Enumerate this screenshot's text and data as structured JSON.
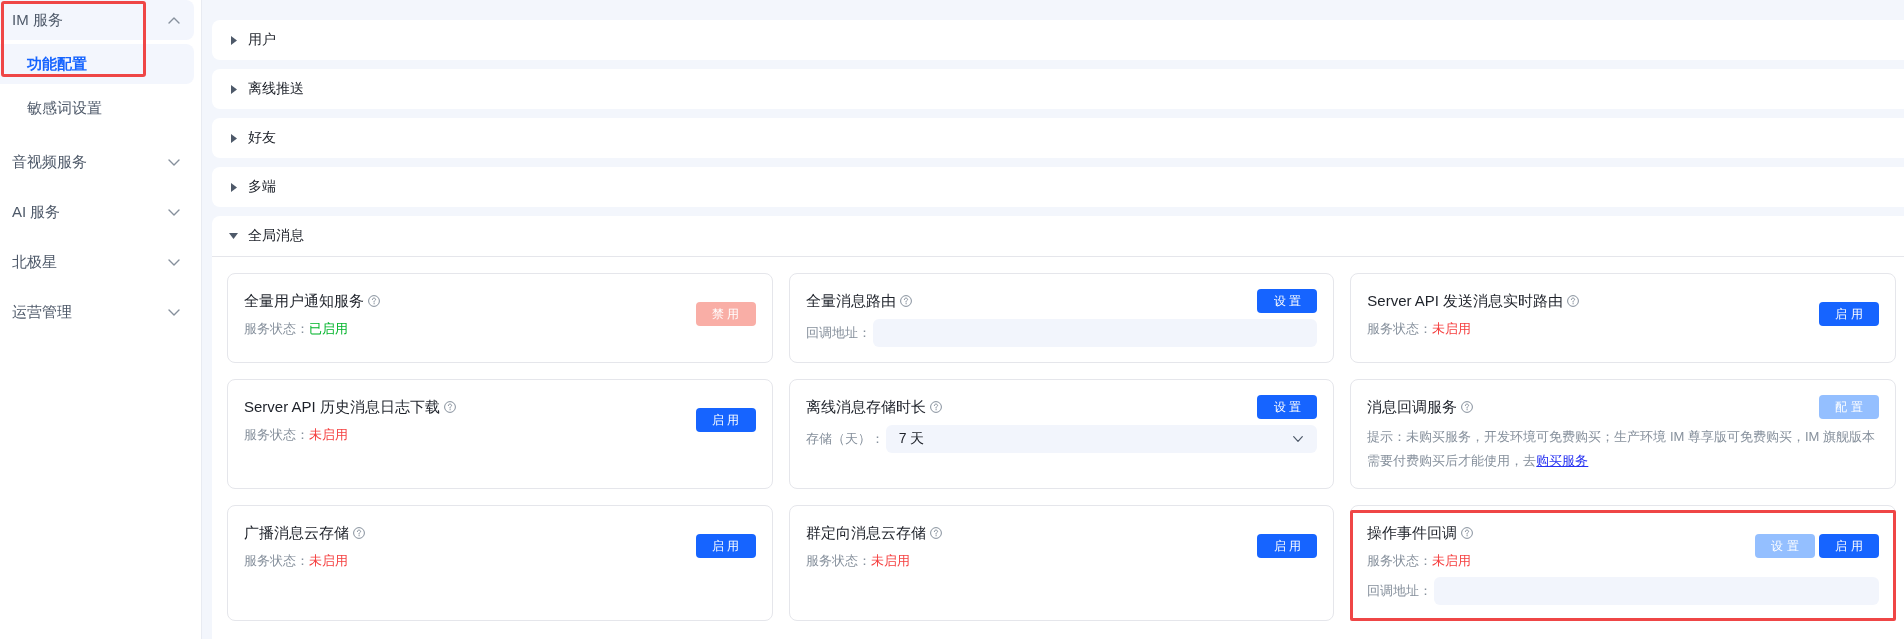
{
  "sidebar": {
    "items": [
      {
        "label": "IM 服务",
        "expanded": true,
        "highlighted": true,
        "children": [
          {
            "label": "功能配置",
            "selected": true
          },
          {
            "label": "敏感词设置",
            "selected": false
          }
        ]
      },
      {
        "label": "音视频服务",
        "expanded": false,
        "highlighted": false
      },
      {
        "label": "AI 服务",
        "expanded": false,
        "highlighted": false
      },
      {
        "label": "北极星",
        "expanded": false,
        "highlighted": false
      },
      {
        "label": "运营管理",
        "expanded": false,
        "highlighted": false
      }
    ]
  },
  "sections": [
    {
      "title": "用户",
      "expanded": false
    },
    {
      "title": "离线推送",
      "expanded": false
    },
    {
      "title": "好友",
      "expanded": false
    },
    {
      "title": "多端",
      "expanded": false
    },
    {
      "title": "全局消息",
      "expanded": true,
      "cards": [
        {
          "title": "全量用户通知服务",
          "highlighted": false,
          "status": {
            "label": "服务状态：",
            "value": "已启用",
            "enabled": true
          },
          "buttons": [
            {
              "label": "禁 用",
              "kind": "danger",
              "disabled": true
            }
          ]
        },
        {
          "title": "全量消息路由",
          "highlighted": false,
          "buttons": [
            {
              "label": "设 置",
              "kind": "primary",
              "disabled": false
            }
          ],
          "field": {
            "kind": "input",
            "label": "回调地址："
          }
        },
        {
          "title": "Server API 发送消息实时路由",
          "highlighted": false,
          "status": {
            "label": "服务状态：",
            "value": "未启用",
            "enabled": false
          },
          "buttons": [
            {
              "label": "启 用",
              "kind": "primary",
              "disabled": false
            }
          ]
        },
        {
          "title": "Server API 历史消息日志下载",
          "highlighted": false,
          "status": {
            "label": "服务状态：",
            "value": "未启用",
            "enabled": false
          },
          "buttons": [
            {
              "label": "启 用",
              "kind": "primary",
              "disabled": false
            }
          ]
        },
        {
          "title": "离线消息存储时长",
          "highlighted": false,
          "buttons": [
            {
              "label": "设 置",
              "kind": "primary",
              "disabled": false
            }
          ],
          "field": {
            "kind": "select",
            "label": "存储（天）：",
            "value": "7 天"
          }
        },
        {
          "title": "消息回调服务",
          "highlighted": false,
          "buttons": [
            {
              "label": "配 置",
              "kind": "primary",
              "disabled": true
            }
          ],
          "notice": {
            "text": "提示：未购买服务，开发环境可免费购买；生产环境 IM 尊享版可免费购买，IM 旗舰版本需要付费购买后才能使用，去",
            "link": "购买服务"
          }
        },
        {
          "title": "广播消息云存储",
          "highlighted": false,
          "status": {
            "label": "服务状态：",
            "value": "未启用",
            "enabled": false
          },
          "buttons": [
            {
              "label": "启 用",
              "kind": "primary",
              "disabled": false
            }
          ]
        },
        {
          "title": "群定向消息云存储",
          "highlighted": false,
          "status": {
            "label": "服务状态：",
            "value": "未启用",
            "enabled": false
          },
          "buttons": [
            {
              "label": "启 用",
              "kind": "primary",
              "disabled": false
            }
          ]
        },
        {
          "title": "操作事件回调",
          "highlighted": true,
          "status": {
            "label": "服务状态：",
            "value": "未启用",
            "enabled": false
          },
          "buttons": [
            {
              "label": "设 置",
              "kind": "primary",
              "disabled": true
            },
            {
              "label": "启 用",
              "kind": "primary",
              "disabled": false
            }
          ],
          "field": {
            "kind": "input",
            "label": "回调地址："
          }
        }
      ]
    }
  ]
}
